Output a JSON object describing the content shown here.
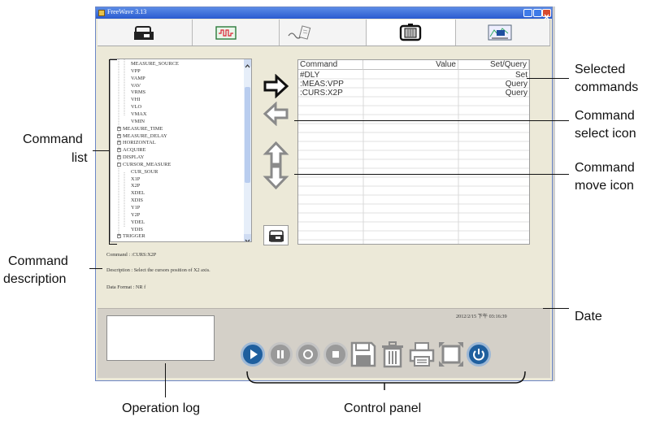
{
  "window": {
    "title": "FreeWave 3.13"
  },
  "tabs": [
    {
      "name": "connect"
    },
    {
      "name": "waveform"
    },
    {
      "name": "script"
    },
    {
      "name": "command"
    },
    {
      "name": "measure"
    }
  ],
  "tree": {
    "items": [
      {
        "label": "MEASURE_SOURCE",
        "level": 2
      },
      {
        "label": "VPP",
        "level": 2
      },
      {
        "label": "VAMP",
        "level": 2
      },
      {
        "label": "VAV",
        "level": 2
      },
      {
        "label": "VRMS",
        "level": 2
      },
      {
        "label": "VHI",
        "level": 2
      },
      {
        "label": "VLO",
        "level": 2
      },
      {
        "label": "VMAX",
        "level": 2
      },
      {
        "label": "VMIN",
        "level": 2
      },
      {
        "label": "MEASURE_TIME",
        "level": 1,
        "expander": "+"
      },
      {
        "label": "MEASURE_DELAY",
        "level": 1,
        "expander": "+"
      },
      {
        "label": "HORIZONTAL",
        "level": 1,
        "expander": "+"
      },
      {
        "label": "ACQUIRE",
        "level": 1,
        "expander": "+"
      },
      {
        "label": "DISPLAY",
        "level": 1,
        "expander": "+"
      },
      {
        "label": "CURSOR_MEASURE",
        "level": 1,
        "expander": "−"
      },
      {
        "label": "CUR_SOUR",
        "level": 2
      },
      {
        "label": "X1P",
        "level": 2
      },
      {
        "label": "X2P",
        "level": 2
      },
      {
        "label": "XDEL",
        "level": 2
      },
      {
        "label": "XDIS",
        "level": 2
      },
      {
        "label": "Y1P",
        "level": 2
      },
      {
        "label": "Y2P",
        "level": 2
      },
      {
        "label": "YDEL",
        "level": 2
      },
      {
        "label": "YDIS",
        "level": 2
      },
      {
        "label": "TRIGGER",
        "level": 1,
        "expander": "+"
      }
    ]
  },
  "table": {
    "headers": [
      "Command",
      "Value",
      "Set/Query"
    ],
    "rows": [
      {
        "command": "#DLY",
        "value": "",
        "setquery": "Set"
      },
      {
        "command": ":MEAS:VPP",
        "value": "",
        "setquery": "Query"
      },
      {
        "command": ":CURS:X2P",
        "value": "",
        "setquery": "Query"
      }
    ]
  },
  "details": {
    "command_label": "Command :",
    "command_value": ":CURS:X2P",
    "description_label": "Description :",
    "description_value": "Select the cursors position of X2 axis.",
    "format_label": "Data Format :",
    "format_value": "NR f"
  },
  "date": "2012/2/15 下午 03:16:39",
  "controls": [
    {
      "name": "play"
    },
    {
      "name": "pause"
    },
    {
      "name": "record"
    },
    {
      "name": "stop"
    },
    {
      "name": "save"
    },
    {
      "name": "delete"
    },
    {
      "name": "print"
    },
    {
      "name": "fullscreen"
    },
    {
      "name": "power"
    }
  ],
  "callouts": {
    "command_list_1": "Command",
    "command_list_2": "list",
    "command_description_1": "Command",
    "command_description_2": "description",
    "selected_commands_1": "Selected",
    "selected_commands_2": "commands",
    "command_select_icon_1": "Command",
    "command_select_icon_2": "select icon",
    "command_move_icon_1": "Command",
    "command_move_icon_2": "move icon",
    "date": "Date",
    "operation_log": "Operation log",
    "control_panel": "Control panel"
  },
  "colors": {
    "accent_blue": "#1f6fb2",
    "arrow_dark": "#1a1a1a",
    "arrow_gray": "#8a8a8a"
  }
}
